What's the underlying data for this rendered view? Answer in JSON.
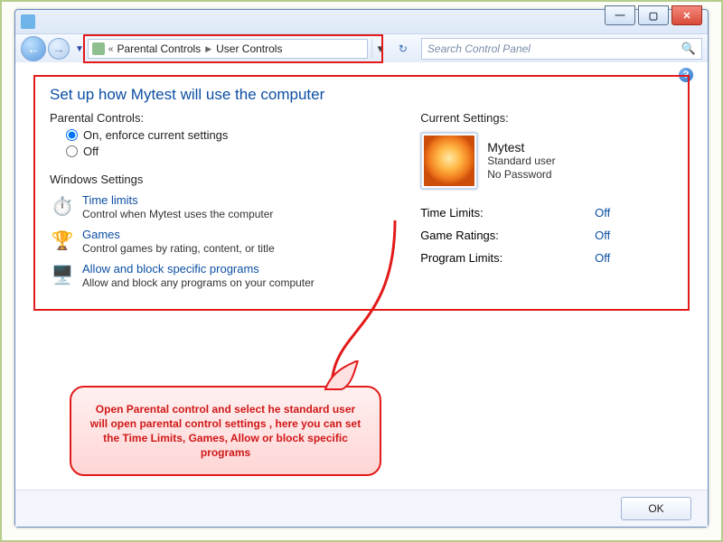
{
  "titlebar": {
    "title": ""
  },
  "breadcrumb": {
    "back_label": "«",
    "crumb1": "Parental Controls",
    "crumb2": "User Controls"
  },
  "search": {
    "placeholder": "Search Control Panel"
  },
  "page": {
    "title": "Set up how Mytest will use the computer"
  },
  "parental": {
    "label": "Parental Controls:",
    "on_label": "On, enforce current settings",
    "off_label": "Off",
    "selected": "on"
  },
  "windows_settings": {
    "heading": "Windows Settings",
    "time_limits": {
      "title": "Time limits",
      "desc": "Control when Mytest uses the computer"
    },
    "games": {
      "title": "Games",
      "desc": "Control games by rating, content, or title"
    },
    "programs": {
      "title": "Allow and block specific programs",
      "desc": "Allow and block any programs on your computer"
    }
  },
  "current": {
    "label": "Current Settings:",
    "user_name": "Mytest",
    "user_role": "Standard user",
    "user_pwd": "No Password",
    "rows": {
      "time_limits": {
        "label": "Time Limits:",
        "value": "Off"
      },
      "game_ratings": {
        "label": "Game Ratings:",
        "value": "Off"
      },
      "program_limits": {
        "label": "Program Limits:",
        "value": "Off"
      }
    }
  },
  "buttons": {
    "ok": "OK"
  },
  "callout": {
    "text": "Open Parental control and select he standard user will open parental control settings , here you can set the Time Limits, Games, Allow or block specific programs"
  },
  "colors": {
    "accent": "#0c4fa3",
    "annotation": "#e21a1a"
  }
}
